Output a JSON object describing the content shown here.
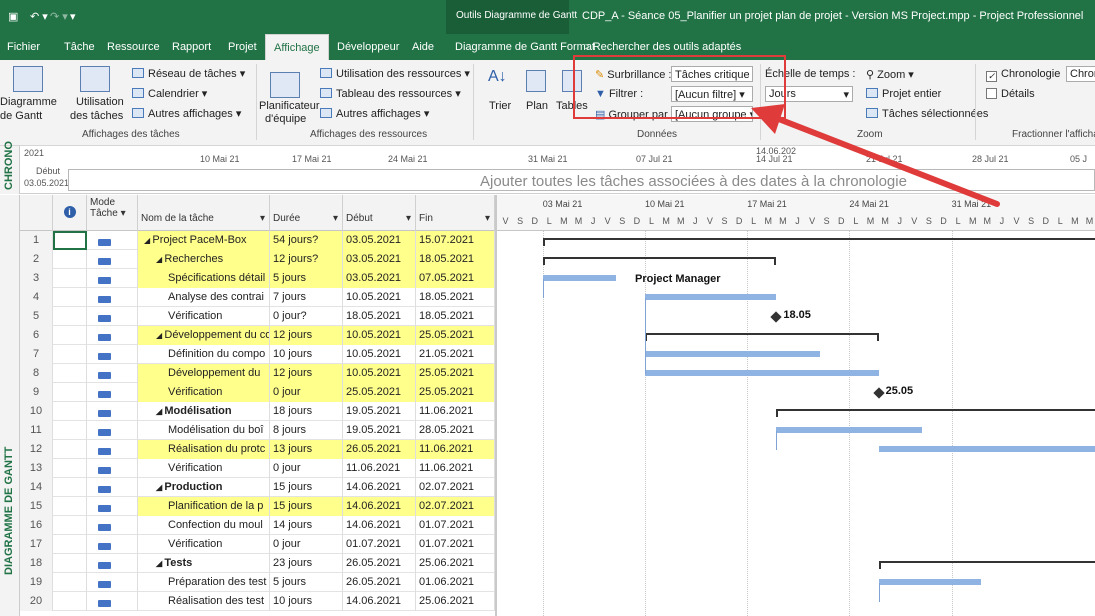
{
  "title_bar": {
    "undo_icon": "undo-arrow",
    "save_icon": "floppy-disk",
    "context_tab": "Outils Diagramme de Gantt",
    "window_title": "CDP_A - Séance 05_Planifier un projet plan de projet - Version MS Project.mpp  -  Project Professionnel"
  },
  "menu": {
    "items": [
      "Fichier",
      "Tâche",
      "Ressource",
      "Rapport",
      "Projet",
      "Affichage",
      "Développeur",
      "Aide",
      "Diagramme de Gantt Format"
    ],
    "active": "Affichage",
    "search_label": "Rechercher des outils adaptés"
  },
  "ribbon": {
    "task_views": {
      "gantt_line1": "Diagramme",
      "gantt_line2": "de Gantt",
      "usage_line1": "Utilisation",
      "usage_line2": "des tâches",
      "network": "Réseau de tâches",
      "calendar": "Calendrier",
      "other_views": "Autres affichages",
      "group_label": "Affichages des tâches"
    },
    "resource_views": {
      "planner_line1": "Planificateur",
      "planner_line2": "d'équipe",
      "resource_usage": "Utilisation des ressources",
      "resource_sheet": "Tableau des ressources",
      "other_views": "Autres affichages",
      "group_label": "Affichages des ressources"
    },
    "data": {
      "sort": "Trier",
      "outline": "Plan",
      "tables": "Tables",
      "highlight_label": "Surbrillance :",
      "highlight_value": "Tâches critique",
      "filter_label": "Filtrer :",
      "filter_value": "[Aucun filtre]",
      "group_label": "Grouper par :",
      "group_value": "[Aucun groupe",
      "section_label": "Données"
    },
    "zoom": {
      "timescale_label": "Échelle de temps :",
      "timescale_value": "Jours",
      "zoom": "Zoom",
      "entire_project": "Projet entier",
      "selected_tasks": "Tâches sélectionnées",
      "section_label": "Zoom"
    },
    "split": {
      "timeline": "Chronologie",
      "timeline_value": "Chrono",
      "details": "Détails",
      "section_label": "Fractionner l'afficha"
    }
  },
  "timeline": {
    "side_label": "CHRONO",
    "year": "2021",
    "start_label": "Début",
    "start_date": "03.05.2021",
    "today_marker": "14.06.202",
    "ticks": [
      "10 Mai 21",
      "17 Mai 21",
      "24 Mai 21",
      "31 Mai 21",
      "07 Jul 21",
      "14 Jul 21",
      "21 Jul 21",
      "28 Jul 21",
      "05 J"
    ],
    "hint": "Ajouter toutes les tâches associées à des dates à la chronologie"
  },
  "gantt_side_label": "DIAGRAMME DE GANTT",
  "table": {
    "headers": {
      "info": "i",
      "mode_line1": "Mode",
      "mode_line2": "Tâche",
      "name": "Nom de la tâche",
      "duration": "Durée",
      "start": "Début",
      "end": "Fin"
    },
    "rows": [
      {
        "id": "1",
        "name": "Project PaceM-Box",
        "duration": "54 jours?",
        "start": "03.05.2021",
        "end": "15.07.2021"
      },
      {
        "id": "2",
        "name": "Recherches",
        "duration": "12 jours?",
        "start": "03.05.2021",
        "end": "18.05.2021"
      },
      {
        "id": "3",
        "name": "Spécifications détail",
        "duration": "5 jours",
        "start": "03.05.2021",
        "end": "07.05.2021"
      },
      {
        "id": "4",
        "name": "Analyse des contrai",
        "duration": "7 jours",
        "start": "10.05.2021",
        "end": "18.05.2021"
      },
      {
        "id": "5",
        "name": "Vérification",
        "duration": "0 jour?",
        "start": "18.05.2021",
        "end": "18.05.2021"
      },
      {
        "id": "6",
        "name": "Développement du co",
        "duration": "12 jours",
        "start": "10.05.2021",
        "end": "25.05.2021"
      },
      {
        "id": "7",
        "name": "Définition du compo",
        "duration": "10 jours",
        "start": "10.05.2021",
        "end": "21.05.2021"
      },
      {
        "id": "8",
        "name": "Développement du",
        "duration": "12 jours",
        "start": "10.05.2021",
        "end": "25.05.2021"
      },
      {
        "id": "9",
        "name": "Vérification",
        "duration": "0 jour",
        "start": "25.05.2021",
        "end": "25.05.2021"
      },
      {
        "id": "10",
        "name": "Modélisation",
        "duration": "18 jours",
        "start": "19.05.2021",
        "end": "11.06.2021"
      },
      {
        "id": "11",
        "name": "Modélisation du boî",
        "duration": "8 jours",
        "start": "19.05.2021",
        "end": "28.05.2021"
      },
      {
        "id": "12",
        "name": "Réalisation du protc",
        "duration": "13 jours",
        "start": "26.05.2021",
        "end": "11.06.2021"
      },
      {
        "id": "13",
        "name": "Vérification",
        "duration": "0 jour",
        "start": "11.06.2021",
        "end": "11.06.2021"
      },
      {
        "id": "14",
        "name": "Production",
        "duration": "15 jours",
        "start": "14.06.2021",
        "end": "02.07.2021"
      },
      {
        "id": "15",
        "name": "Planification de la p",
        "duration": "15 jours",
        "start": "14.06.2021",
        "end": "02.07.2021"
      },
      {
        "id": "16",
        "name": "Confection du moul",
        "duration": "14 jours",
        "start": "14.06.2021",
        "end": "01.07.2021"
      },
      {
        "id": "17",
        "name": "Vérification",
        "duration": "0 jour",
        "start": "01.07.2021",
        "end": "01.07.2021"
      },
      {
        "id": "18",
        "name": "Tests",
        "duration": "23 jours",
        "start": "26.05.2021",
        "end": "25.06.2021"
      },
      {
        "id": "19",
        "name": "Préparation des test",
        "duration": "5 jours",
        "start": "26.05.2021",
        "end": "01.06.2021"
      },
      {
        "id": "20",
        "name": "Réalisation des test",
        "duration": "10 jours",
        "start": "14.06.2021",
        "end": "25.06.2021"
      }
    ]
  },
  "chart": {
    "weeks": [
      "03 Mai 21",
      "10 Mai 21",
      "17 Mai 21",
      "24 Mai 21",
      "31 Mai 21"
    ],
    "day_letters": [
      "V",
      "S",
      "D",
      "L",
      "M",
      "M",
      "J",
      "V",
      "S",
      "D",
      "L",
      "M",
      "M",
      "J",
      "V",
      "S",
      "D",
      "L",
      "M",
      "M",
      "J",
      "V",
      "S",
      "D",
      "L",
      "M",
      "M",
      "J",
      "V",
      "S",
      "D",
      "L",
      "M",
      "M",
      "J",
      "V",
      "S",
      "D",
      "L",
      "M",
      "M"
    ],
    "resource_label": "Project Manager",
    "milestone_1": "18.05",
    "milestone_2": "25.05"
  },
  "colors": {
    "ribbon_green": "#217346",
    "bar_blue": "#8fb4e3",
    "highlight_yellow": "#ffff8c",
    "callout_red": "#e03b3b"
  }
}
